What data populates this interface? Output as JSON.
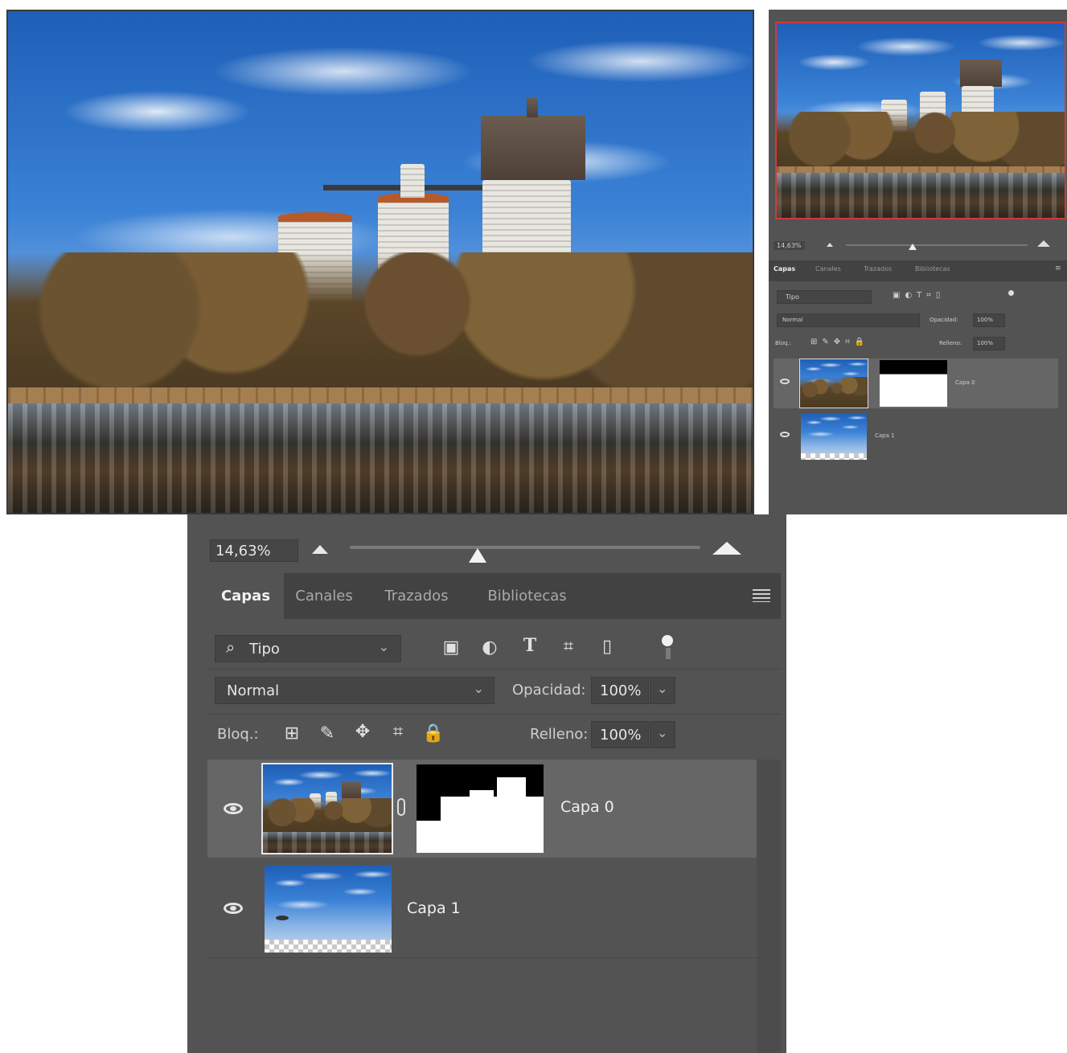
{
  "zoom": {
    "value": "14,63%",
    "slider_fraction": 0.36
  },
  "tabs": [
    {
      "label": "Capas",
      "active": true
    },
    {
      "label": "Canales",
      "active": false
    },
    {
      "label": "Trazados",
      "active": false
    },
    {
      "label": "Bibliotecas",
      "active": false
    }
  ],
  "filter": {
    "label": "Tipo",
    "icons": [
      "image-filter-icon",
      "adjustment-filter-icon",
      "type-filter-icon",
      "shape-filter-icon",
      "smart-object-filter-icon",
      "filter-toggle-icon"
    ]
  },
  "blend": {
    "mode": "Normal",
    "opacity_label": "Opacidad:",
    "opacity_value": "100%"
  },
  "lock": {
    "label": "Bloq.:",
    "fill_label": "Relleno:",
    "fill_value": "100%"
  },
  "layers": [
    {
      "name": "Capa 0",
      "selected": true,
      "has_mask": true,
      "visible": true
    },
    {
      "name": "Capa 1",
      "selected": false,
      "has_mask": false,
      "visible": true
    }
  ],
  "colors": {
    "panel": "#535353",
    "field": "#454545",
    "selected_row": "#666666",
    "nav_frame": "#d03a3a"
  }
}
